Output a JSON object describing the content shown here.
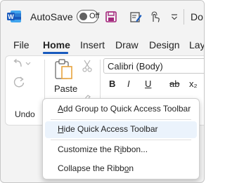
{
  "qat": {
    "autosave_label": "AutoSave",
    "autosave_state": "Off",
    "doc_title": "Do",
    "icons": [
      "word-logo",
      "save-icon",
      "edit-document-icon",
      "touch-mode-icon",
      "customize-qat-icon"
    ]
  },
  "tabs": [
    {
      "label": "File"
    },
    {
      "label": "Home",
      "active": true
    },
    {
      "label": "Insert"
    },
    {
      "label": "Draw"
    },
    {
      "label": "Design"
    },
    {
      "label": "Lay"
    }
  ],
  "ribbon": {
    "undo_label": "Undo",
    "paste_label": "Paste",
    "font_name": "Calibri (Body)",
    "format_buttons": [
      "B",
      "I",
      "U",
      "ab",
      "x₂"
    ]
  },
  "context_menu": {
    "items": [
      {
        "label": "Add Group to Quick Access Toolbar",
        "underline_index": 0
      },
      {
        "label": "Hide Quick Access Toolbar",
        "underline_index": 0,
        "highlighted": true
      },
      {
        "label": "Customize the Ribbon...",
        "underline_index": 15
      },
      {
        "label": "Collapse the Ribbon",
        "underline_index": 17
      }
    ]
  },
  "colors": {
    "accent": "#185abd",
    "word_blue": "#185abd",
    "save_purple": "#a4277c",
    "menu_highlight": "#ebf3fc"
  }
}
